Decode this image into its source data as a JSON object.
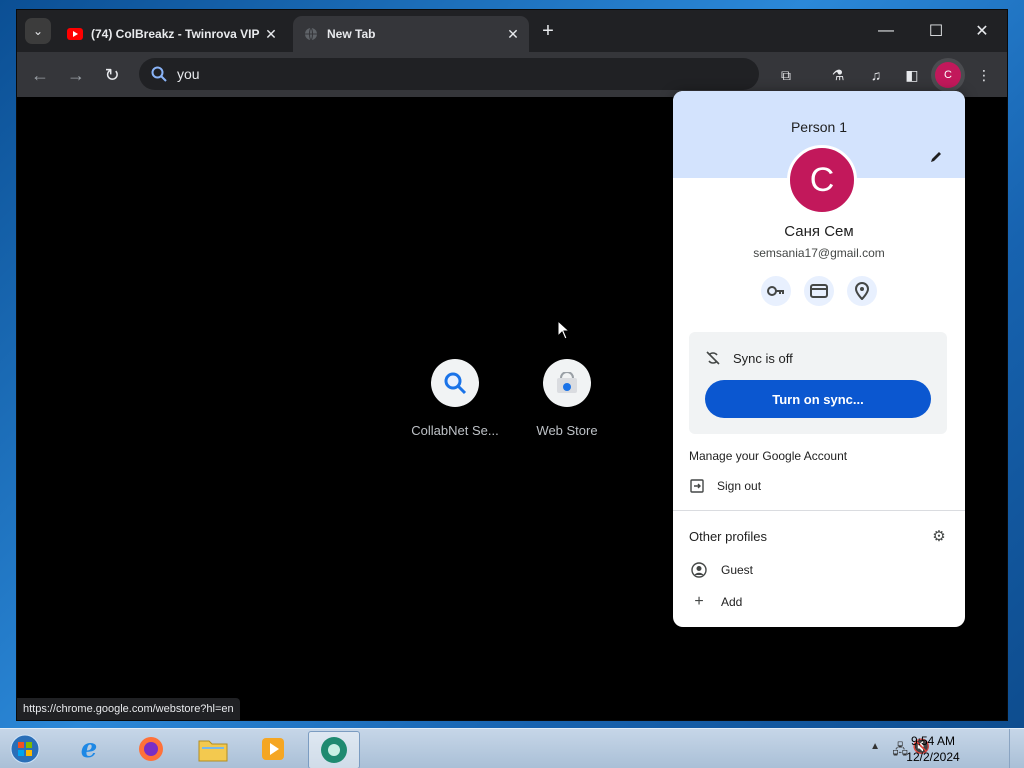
{
  "colors": {
    "browser_dark": "#202124",
    "toolbar": "#35363a",
    "accent_blue": "#0b57d0",
    "avatar_pink": "#c2185b",
    "popup_header": "#d3e3fd"
  },
  "tabs": [
    {
      "title": "(74) ColBreakz - Twinrova VIP",
      "favicon": "youtube-icon"
    },
    {
      "title": "New Tab",
      "favicon": "globe-icon"
    }
  ],
  "omnibox": {
    "text": "you"
  },
  "toolbar": {
    "avatar_initial": "C"
  },
  "shortcuts": [
    {
      "label": "CollabNet Se...",
      "icon": "search-icon"
    },
    {
      "label": "Web Store",
      "icon": "webstore-icon"
    }
  ],
  "status_url": "https://chrome.google.com/webstore?hl=en",
  "profile_menu": {
    "header_name": "Person 1",
    "avatar_initial": "C",
    "full_name": "Саня Сем",
    "email": "semsania17@gmail.com",
    "sync_status": "Sync is off",
    "sync_button": "Turn on sync...",
    "manage_account": "Manage your Google Account",
    "sign_out": "Sign out",
    "other_profiles_title": "Other profiles",
    "guest": "Guest",
    "add": "Add"
  },
  "taskbar": {
    "time": "9:54 AM",
    "date": "12/2/2024"
  }
}
